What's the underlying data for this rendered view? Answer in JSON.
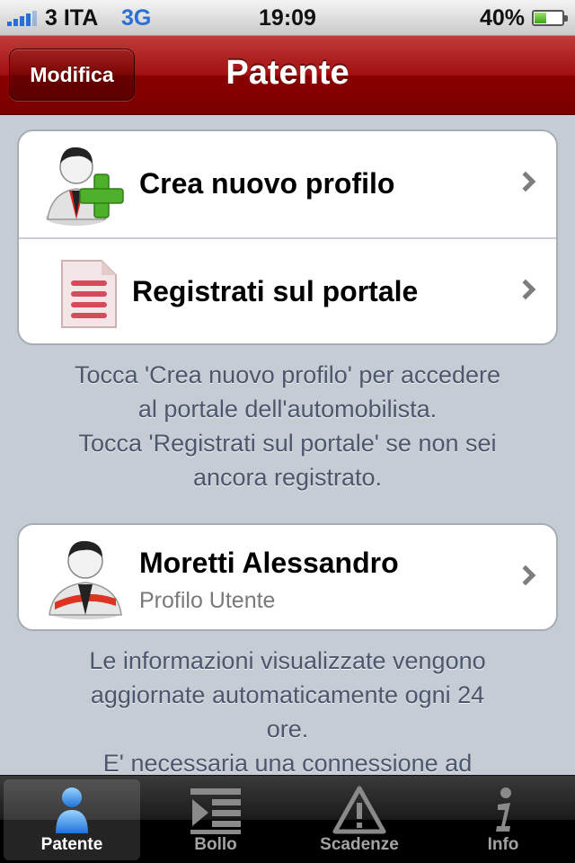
{
  "status_bar": {
    "carrier": "3 ITA",
    "network": "3G",
    "time": "19:09",
    "battery_percent": "40%",
    "battery_level": 0.4
  },
  "nav": {
    "title": "Patente",
    "edit_button": "Modifica"
  },
  "actions": [
    {
      "label": "Crea nuovo profilo",
      "icon": "add-user-icon"
    },
    {
      "label": "Registrati sul portale",
      "icon": "document-icon"
    }
  ],
  "actions_help": [
    "Tocca 'Crea nuovo profilo' per accedere",
    "al portale dell'automobilista.",
    "Tocca 'Registrati sul portale' se non sei",
    "ancora registrato."
  ],
  "profile": {
    "name": "Moretti Alessandro",
    "subtitle": "Profilo Utente",
    "icon": "user-profile-icon"
  },
  "info_text": [
    "Le informazioni visualizzate vengono",
    "aggiornate automaticamente ogni 24",
    "ore.",
    "E' necessaria una connessione ad"
  ],
  "tabs": [
    {
      "label": "Patente",
      "icon": "person-icon",
      "active": true
    },
    {
      "label": "Bollo",
      "icon": "list-icon",
      "active": false
    },
    {
      "label": "Scadenze",
      "icon": "warning-icon",
      "active": false
    },
    {
      "label": "Info",
      "icon": "info-icon",
      "active": false
    }
  ],
  "colors": {
    "nav_red": "#8a0000",
    "background": "#c5ccd4",
    "accent_blue": "#2a6fd6",
    "plus_green": "#4fb12b"
  }
}
